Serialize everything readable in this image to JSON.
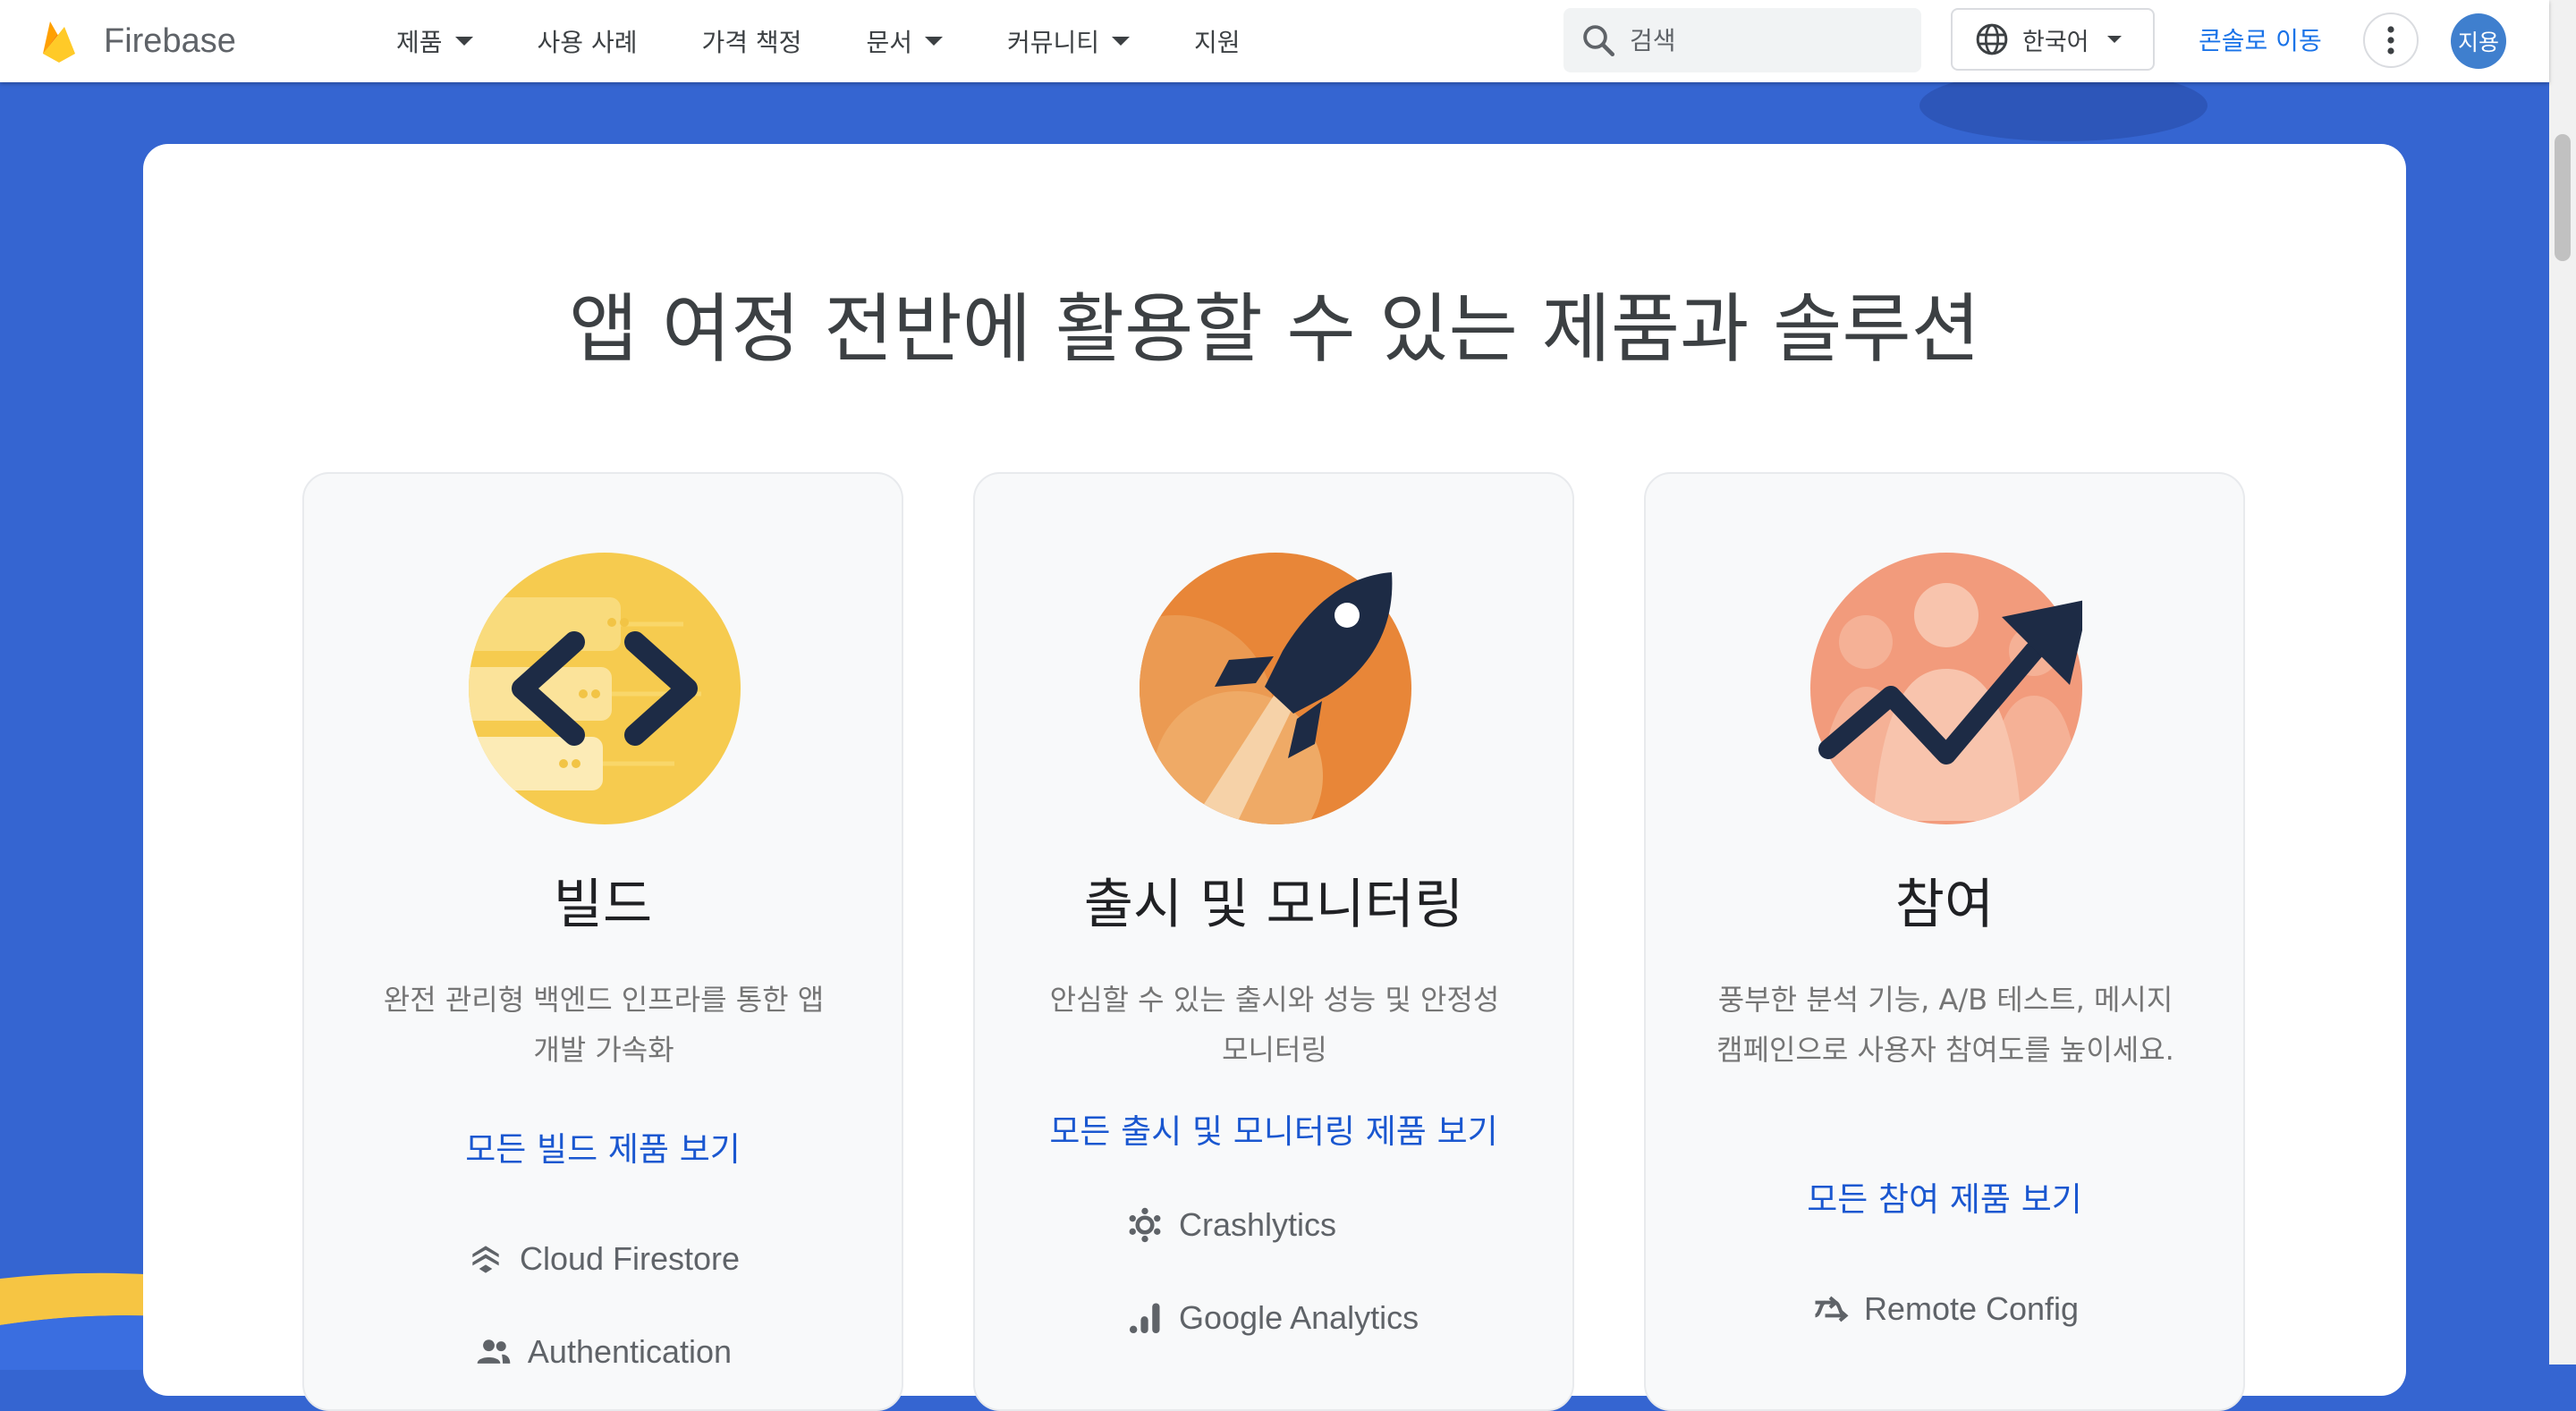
{
  "header": {
    "brand": "Firebase",
    "nav": [
      {
        "label": "제품",
        "dropdown": true
      },
      {
        "label": "사용 사례",
        "dropdown": false
      },
      {
        "label": "가격 책정",
        "dropdown": false
      },
      {
        "label": "문서",
        "dropdown": true
      },
      {
        "label": "커뮤니티",
        "dropdown": true
      },
      {
        "label": "지원",
        "dropdown": false
      }
    ],
    "search_placeholder": "검색",
    "language": "한국어",
    "console_link": "콘솔로 이동",
    "avatar_text": "지용"
  },
  "main": {
    "heading": "앱 여정 전반에 활용할 수 있는 제품과 솔루션",
    "cards": [
      {
        "title": "빌드",
        "description": "완전 관리형 백엔드 인프라를 통한 앱 개발 가속화",
        "link": "모든 빌드 제품 보기",
        "products": [
          {
            "name": "Cloud Firestore",
            "icon": "firestore-icon"
          },
          {
            "name": "Authentication",
            "icon": "authentication-icon"
          }
        ]
      },
      {
        "title": "출시 및 모니터링",
        "description": "안심할 수 있는 출시와 성능 및 안정성 모니터링",
        "link": "모든 출시 및 모니터링 제품 보기",
        "products": [
          {
            "name": "Crashlytics",
            "icon": "crashlytics-icon"
          },
          {
            "name": "Google Analytics",
            "icon": "analytics-icon"
          }
        ]
      },
      {
        "title": "참여",
        "description": "풍부한 분석 기능, A/B 테스트, 메시지 캠페인으로 사용자 참여도를 높이세요.",
        "link": "모든 참여 제품 보기",
        "products": [
          {
            "name": "Remote Config",
            "icon": "remote-config-icon"
          }
        ]
      }
    ]
  },
  "colors": {
    "page_background": "#3565d1",
    "link": "#1a57d0",
    "build_circle": "#f6cb4f",
    "release_circle": "#e88638",
    "engage_circle": "#f29b7c",
    "illustration_dark": "#1d2b45"
  }
}
